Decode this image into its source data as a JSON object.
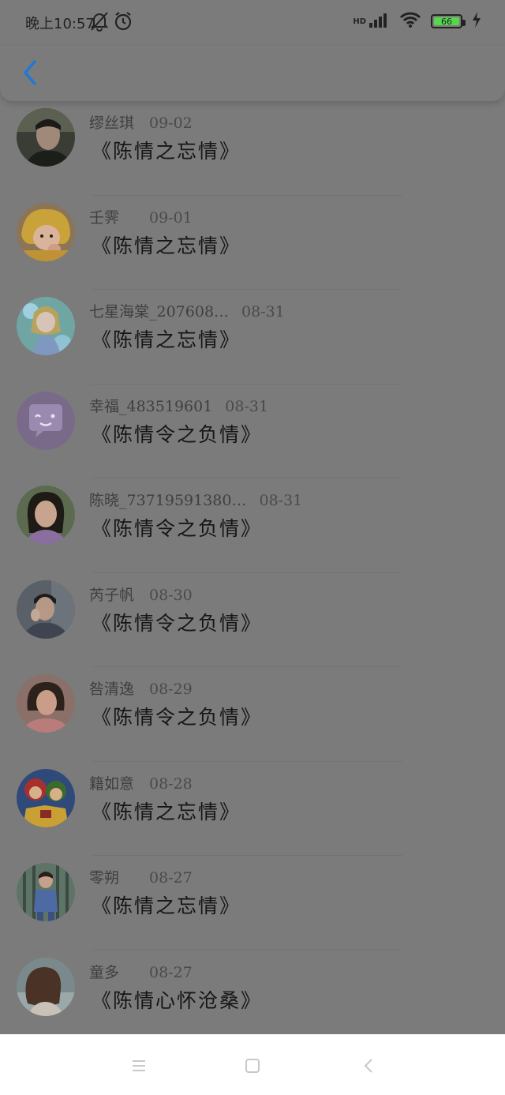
{
  "status_bar": {
    "time": "晚上10:57",
    "hd": "HD",
    "battery": "66"
  },
  "header": {
    "back_icon": "chevron-left-icon",
    "accent_color": "#1e78d6"
  },
  "items": [
    {
      "name": "缪丝琪",
      "date": "09-02",
      "message": "《陈情之忘情》",
      "avatar": "man-portrait"
    },
    {
      "name": "壬霁",
      "date": "09-01",
      "message": "《陈情之忘情》",
      "avatar": "child-yellow"
    },
    {
      "name": "七星海棠_207608…",
      "date": "08-31",
      "message": "《陈情之忘情》",
      "avatar": "anime-girl"
    },
    {
      "name": "幸福_483519601",
      "date": "08-31",
      "message": "《陈情令之负情》",
      "avatar": "default-chat"
    },
    {
      "name": "陈晓_73719591380…",
      "date": "08-31",
      "message": "《陈情令之负情》",
      "avatar": "woman-portrait"
    },
    {
      "name": "芮子帆",
      "date": "08-30",
      "message": "《陈情令之负情》",
      "avatar": "man-thinking"
    },
    {
      "name": "咎清逸",
      "date": "08-29",
      "message": "《陈情令之负情》",
      "avatar": "woman-pink"
    },
    {
      "name": "籍如意",
      "date": "08-28",
      "message": "《陈情之忘情》",
      "avatar": "cartoon"
    },
    {
      "name": "零朔",
      "date": "08-27",
      "message": "《陈情之忘情》",
      "avatar": "girl-blue"
    },
    {
      "name": "童多",
      "date": "08-27",
      "message": "《陈情心怀沧桑》",
      "avatar": "woman-back"
    }
  ],
  "nav": {
    "menu_icon": "menu-icon",
    "home_icon": "home-square-icon",
    "back_icon": "back-triangle-icon"
  }
}
